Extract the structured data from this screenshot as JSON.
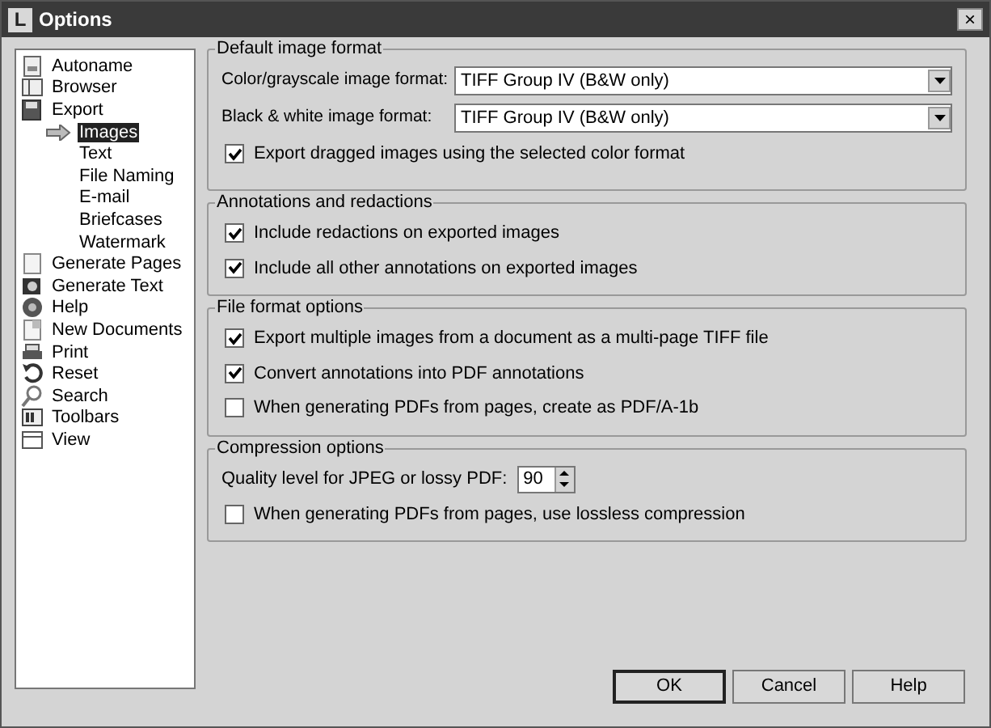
{
  "window": {
    "title": "Options",
    "logo": "L",
    "close": "×"
  },
  "sidebar": {
    "items": [
      {
        "label": "Autoname",
        "selected": false
      },
      {
        "label": "Browser",
        "selected": false
      },
      {
        "label": "Export",
        "selected": false,
        "children": [
          {
            "label": "Images",
            "selected": true
          },
          {
            "label": "Text",
            "selected": false
          },
          {
            "label": "File Naming",
            "selected": false
          },
          {
            "label": "E-mail",
            "selected": false
          },
          {
            "label": "Briefcases",
            "selected": false
          },
          {
            "label": "Watermark",
            "selected": false
          }
        ]
      },
      {
        "label": "Generate Pages",
        "selected": false
      },
      {
        "label": "Generate Text",
        "selected": false
      },
      {
        "label": "Help",
        "selected": false
      },
      {
        "label": "New Documents",
        "selected": false
      },
      {
        "label": "Print",
        "selected": false
      },
      {
        "label": "Reset",
        "selected": false
      },
      {
        "label": "Search",
        "selected": false
      },
      {
        "label": "Toolbars",
        "selected": false
      },
      {
        "label": "View",
        "selected": false
      }
    ]
  },
  "groups": [
    {
      "title": "Default image format",
      "rows": [
        {
          "kind": "select",
          "label": "Color/grayscale image format:",
          "value": "TIFF Group IV (B&W only)"
        },
        {
          "kind": "select",
          "label": "Black & white image format:",
          "value": "TIFF Group IV (B&W only)"
        },
        {
          "kind": "checkbox",
          "label": "Export dragged images using the selected color format",
          "checked": true
        }
      ]
    },
    {
      "title": "Annotations and redactions",
      "rows": [
        {
          "kind": "checkbox",
          "label": "Include redactions on exported images",
          "checked": true
        },
        {
          "kind": "checkbox",
          "label": "Include all other annotations on exported images",
          "checked": true
        }
      ]
    },
    {
      "title": "File format options",
      "rows": [
        {
          "kind": "checkbox",
          "label": "Export multiple images from a document as a multi-page TIFF file",
          "checked": true
        },
        {
          "kind": "checkbox",
          "label": "Convert annotations into PDF annotations",
          "checked": true
        },
        {
          "kind": "checkbox",
          "label": "When generating PDFs from pages, create as PDF/A-1b",
          "checked": false
        }
      ]
    },
    {
      "title": "Compression options",
      "rows": [
        {
          "kind": "spinner",
          "label": "Quality level for JPEG or lossy PDF:",
          "value": "90"
        },
        {
          "kind": "checkbox",
          "label": "When generating PDFs from pages, use lossless compression",
          "checked": false
        }
      ]
    }
  ],
  "buttons": [
    {
      "label": "OK",
      "default": true
    },
    {
      "label": "Cancel",
      "default": false
    },
    {
      "label": "Help",
      "default": false
    }
  ]
}
